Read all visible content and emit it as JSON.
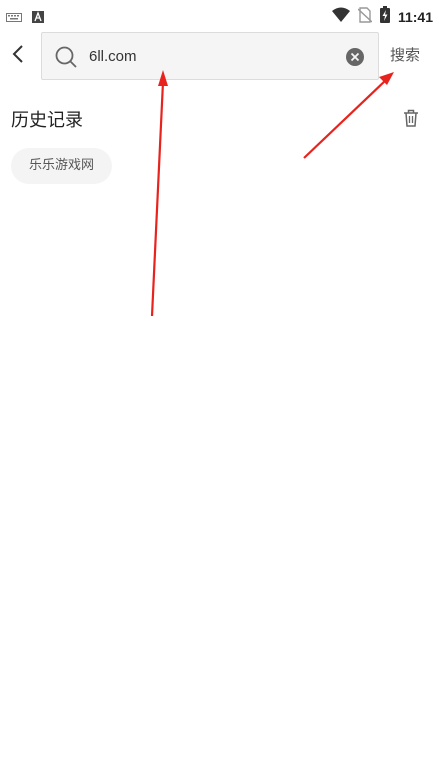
{
  "status_bar": {
    "time": "11:41",
    "left_icons": [
      "keyboard-icon",
      "a-notification-icon"
    ],
    "right_icons": [
      "wifi-icon",
      "no-sim-icon",
      "battery-charging-icon"
    ]
  },
  "header": {
    "search_value": "6ll.com",
    "search_button_label": "搜索"
  },
  "history": {
    "title": "历史记录",
    "items": [
      {
        "label": "乐乐游戏网"
      }
    ]
  },
  "colors": {
    "annotation_arrow": "#e8231d",
    "search_box_bg": "#f5f5f5",
    "chip_bg": "#f4f4f4"
  }
}
